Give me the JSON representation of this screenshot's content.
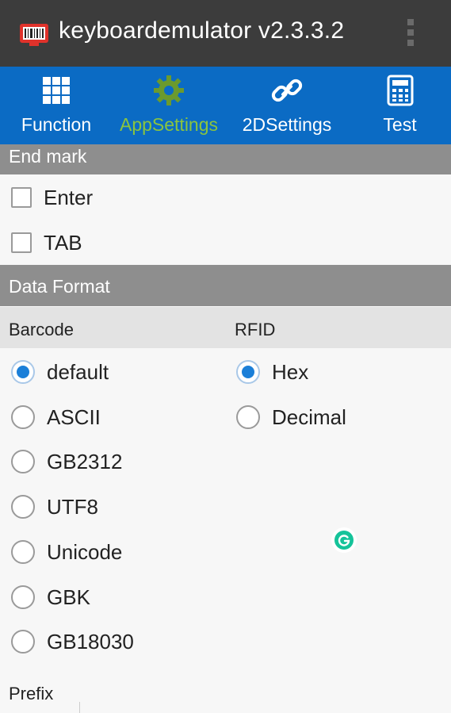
{
  "app": {
    "title": "keyboardemulator v2.3.3.2"
  },
  "tabs": [
    {
      "label": "Function",
      "icon": "grid-icon",
      "active": false
    },
    {
      "label": "AppSettings",
      "icon": "gear-icon",
      "active": true
    },
    {
      "label": "2DSettings",
      "icon": "link-icon",
      "active": false
    },
    {
      "label": "Test",
      "icon": "calculator-icon",
      "active": false
    }
  ],
  "end_mark": {
    "header": "End mark",
    "options": [
      {
        "label": "Enter",
        "checked": false
      },
      {
        "label": "TAB",
        "checked": false
      }
    ]
  },
  "data_format": {
    "header": "Data Format",
    "barcode": {
      "label": "Barcode",
      "options": [
        "default",
        "ASCII",
        "GB2312",
        "UTF8",
        "Unicode",
        "GBK",
        "GB18030"
      ],
      "selected": "default"
    },
    "rfid": {
      "label": "RFID",
      "options": [
        "Hex",
        "Decimal"
      ],
      "selected": "Hex"
    }
  },
  "prefix": {
    "label": "Prefix"
  },
  "colors": {
    "titlebar": "#3c3c3c",
    "tabbar": "#0b6bc4",
    "active_tab": "#8ac43f",
    "radio_checked": "#1b7fd8",
    "section_header": "#8e8e8e",
    "grammarly_badge": "#15c39a"
  }
}
